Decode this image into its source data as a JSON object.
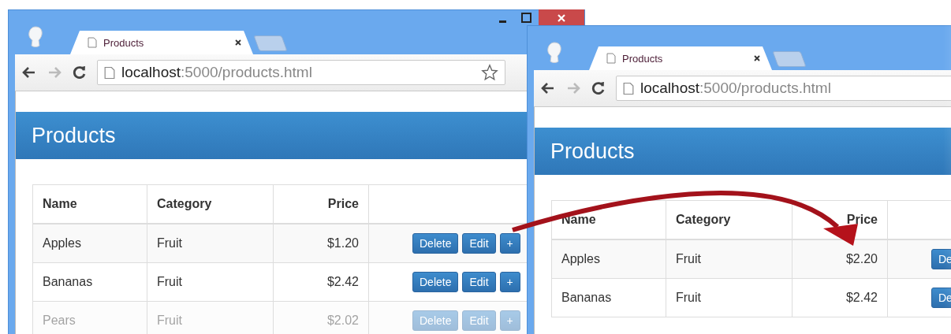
{
  "windows": [
    {
      "tab_title": "Products",
      "url_host": "localhost",
      "url_path": ":5000/products.html",
      "window_controls": true,
      "bookmark_star": true,
      "page_title": "Products",
      "columns": [
        "Name",
        "Category",
        "Price"
      ],
      "rows": [
        {
          "name": "Apples",
          "category": "Fruit",
          "price": "$1.20",
          "faded": false,
          "buttons": [
            "Delete",
            "Edit",
            "+"
          ]
        },
        {
          "name": "Bananas",
          "category": "Fruit",
          "price": "$2.42",
          "faded": false,
          "buttons": [
            "Delete",
            "Edit",
            "+"
          ]
        },
        {
          "name": "Pears",
          "category": "Fruit",
          "price": "$2.02",
          "faded": true,
          "buttons": [
            "Delete",
            "Edit",
            "+"
          ]
        }
      ]
    },
    {
      "tab_title": "Products",
      "url_host": "localhost",
      "url_path": ":5000/products.html",
      "window_controls": false,
      "page_title": "Products",
      "columns": [
        "Name",
        "Category",
        "Price"
      ],
      "rows": [
        {
          "name": "Apples",
          "category": "Fruit",
          "price": "$2.20",
          "faded": false,
          "buttons": [
            "De"
          ]
        },
        {
          "name": "Bananas",
          "category": "Fruit",
          "price": "$2.42",
          "faded": false,
          "buttons": [
            "De"
          ]
        }
      ]
    }
  ]
}
